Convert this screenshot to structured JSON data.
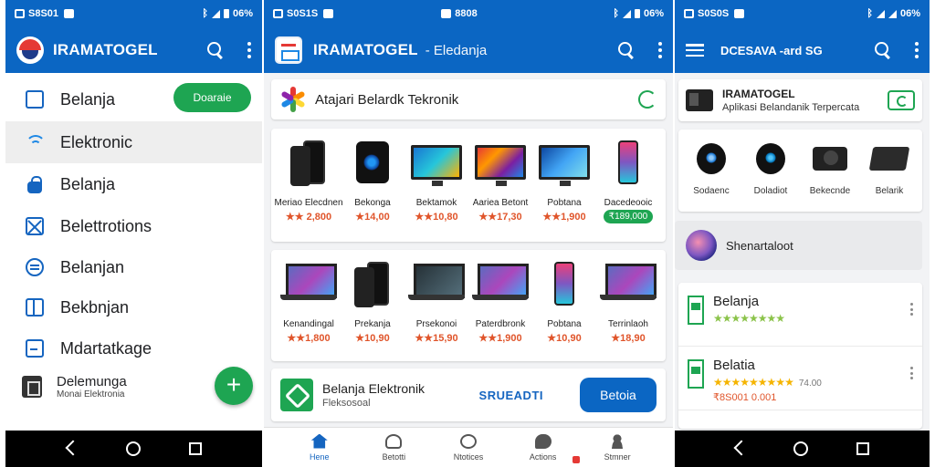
{
  "colors": {
    "primary": "#0b66c3",
    "accent_green": "#1ea552",
    "price": "#e0552b",
    "stars_green": "#8bc34a",
    "stars_gold": "#f5b400"
  },
  "phone1": {
    "status": {
      "time": "S8S01",
      "battery": "06%"
    },
    "appbar": {
      "title": "IRAMATOGEL",
      "logo_icon": "app-logo-icon",
      "search_icon": "search-icon",
      "menu_icon": "more-vert-icon"
    },
    "drawer": {
      "pill_label": "Doaraie",
      "items": [
        {
          "label": "Belanja",
          "icon": "card-icon"
        },
        {
          "label": "Elektronic",
          "icon": "wifi-icon"
        },
        {
          "label": "Belanja",
          "icon": "lock-icon"
        },
        {
          "label": "Belettrotions",
          "icon": "close-box-icon"
        },
        {
          "label": "Belanjan",
          "icon": "chat-icon"
        },
        {
          "label": "Bekbnjan",
          "icon": "package-icon"
        },
        {
          "label": "Mdartatkage",
          "icon": "calendar-icon"
        }
      ],
      "last": {
        "title": "Delemunga",
        "subtitle": "Monai Elektronia"
      },
      "fab_label": "+"
    },
    "navbar": {
      "back": "back-icon",
      "home": "home-icon",
      "recent": "recent-apps-icon"
    }
  },
  "phone2": {
    "status": {
      "time": "S0S1S",
      "center": "8808",
      "battery": "06%"
    },
    "appbar": {
      "title": "IRAMATOGEL",
      "subtitle": "- Eledanja"
    },
    "banner": {
      "text": "Atajari Belardk Tekronik"
    },
    "row1": [
      {
        "name": "Meriao Elecdnen",
        "price": "★★ 2,800"
      },
      {
        "name": "Bekonga",
        "price": "★14,00"
      },
      {
        "name": "Bektamok",
        "price": "★★10,80"
      },
      {
        "name": "Aariea Betont",
        "price": "★★17,30"
      },
      {
        "name": "Pobtana",
        "price": "★★1,900"
      },
      {
        "name": "Dacedeooic",
        "price": "",
        "tag": "₹189,000"
      }
    ],
    "row2": [
      {
        "name": "Kenandingal",
        "price": "★★1,800"
      },
      {
        "name": "Prekanja",
        "price": "★10,90"
      },
      {
        "name": "Prsekonoi",
        "price": "★★15,90"
      },
      {
        "name": "Paterdbronk",
        "price": "★★1,900"
      },
      {
        "name": "Pobtana",
        "price": "★10,90"
      },
      {
        "name": "Terrinlaoh",
        "price": "★18,90"
      }
    ],
    "cta": {
      "title": "Belanja Elektronik",
      "subtitle": "Fleksosoal",
      "link": "SRUEADTI",
      "button": "Betoia"
    },
    "bottom_nav": [
      {
        "label": "Hene",
        "icon": "home-icon",
        "active": true
      },
      {
        "label": "Betotti",
        "icon": "user-icon"
      },
      {
        "label": "Ntotices",
        "icon": "notices-icon"
      },
      {
        "label": "Actions",
        "icon": "actions-icon"
      },
      {
        "label": "Stmner",
        "icon": "profile-icon"
      }
    ]
  },
  "phone3": {
    "status": {
      "time": "S0S0S",
      "battery": "06%"
    },
    "appbar": {
      "title": "DCESAVA -ard SG"
    },
    "header": {
      "title": "IRAMATOGEL",
      "subtitle": "Aplikasi Belandanik Terpercata"
    },
    "grid": [
      {
        "name": "Sodaenc"
      },
      {
        "name": "Doladiot"
      },
      {
        "name": "Bekecnde"
      },
      {
        "name": "Belarik"
      }
    ],
    "banner": {
      "text": "Shenartaloot"
    },
    "list": [
      {
        "title": "Belanja",
        "stars": "★★★★★★★★"
      },
      {
        "title": "Belatia",
        "stars": "★★★★★★★★★",
        "meta": "74.00",
        "price": "₹8S001 0.001"
      }
    ]
  }
}
